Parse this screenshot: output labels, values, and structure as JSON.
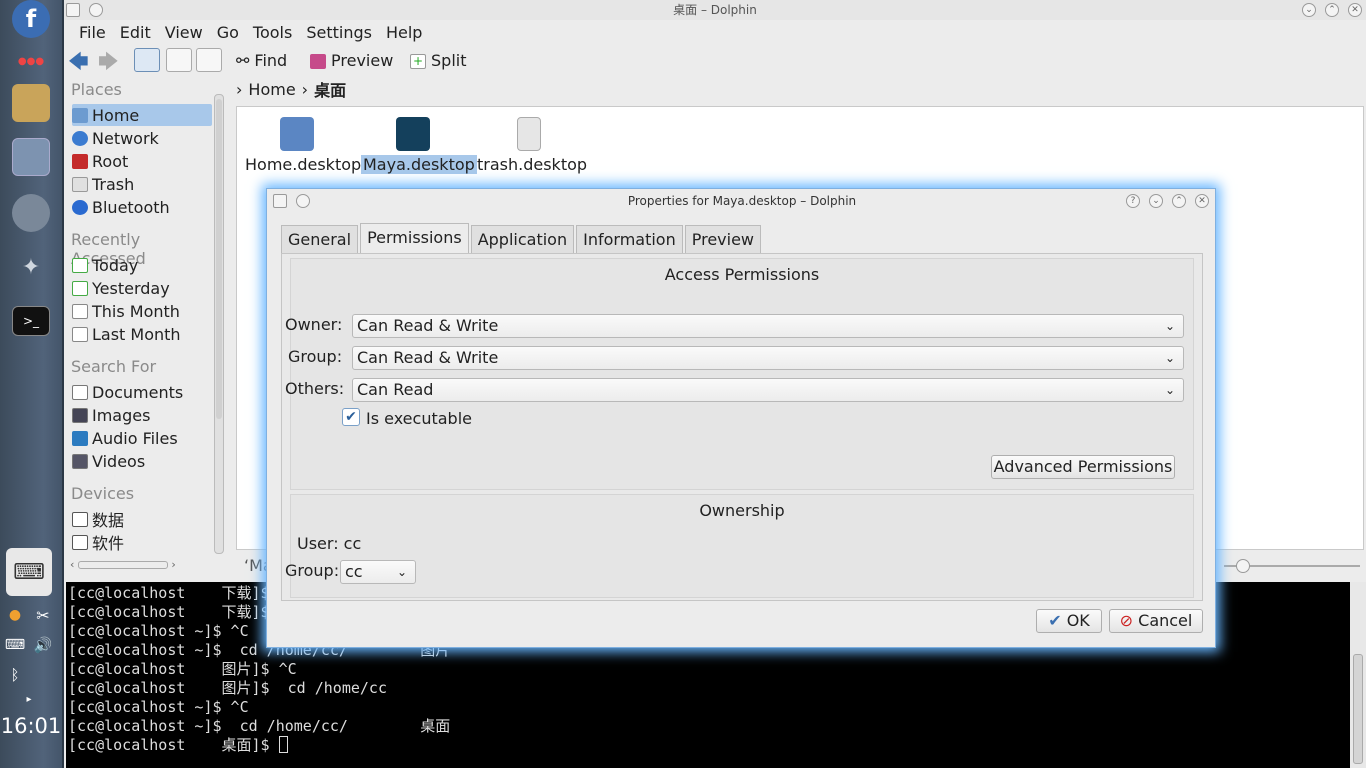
{
  "panel": {
    "clock": "16:01"
  },
  "window": {
    "title": "桌面 – Dolphin"
  },
  "menu": [
    "File",
    "Edit",
    "View",
    "Go",
    "Tools",
    "Settings",
    "Help"
  ],
  "toolbar": {
    "find": "Find",
    "preview": "Preview",
    "split": "Split"
  },
  "places": {
    "heading_places": "Places",
    "places": [
      "Home",
      "Network",
      "Root",
      "Trash",
      "Bluetooth"
    ],
    "heading_recent": "Recently Accessed",
    "recent": [
      "Today",
      "Yesterday",
      "This Month",
      "Last Month"
    ],
    "heading_search": "Search For",
    "search": [
      "Documents",
      "Images",
      "Audio Files",
      "Videos"
    ],
    "heading_devices": "Devices",
    "devices": [
      "数据",
      "软件"
    ]
  },
  "breadcrumb": {
    "home": "Home",
    "current": "桌面"
  },
  "files": [
    "Home.desktop",
    "Maya.desktop",
    "trash.desktop"
  ],
  "status_fragment": "‘Ma",
  "terminal": {
    "lines": [
      "[cc@localhost    下载]$ su",
      "[cc@localhost    下载]$ cd",
      "[cc@localhost ~]$ ^C",
      "[cc@localhost ~]$  cd /home/cc/        图片",
      "[cc@localhost    图片]$ ^C",
      "[cc@localhost    图片]$  cd /home/cc",
      "[cc@localhost ~]$ ^C",
      "[cc@localhost ~]$  cd /home/cc/        桌面",
      "[cc@localhost    桌面]$ "
    ]
  },
  "dialog": {
    "title": "Properties for Maya.desktop – Dolphin",
    "tabs": [
      "General",
      "Permissions",
      "Application",
      "Information",
      "Preview"
    ],
    "access_heading": "Access Permissions",
    "owner_label": "Owner:",
    "owner_value": "Can Read & Write",
    "group_label": "Group:",
    "group_value": "Can Read & Write",
    "others_label": "Others:",
    "others_value": "Can Read",
    "exec_label": "Is executable",
    "advanced_button": "Advanced Permissions",
    "ownership_heading": "Ownership",
    "user_text": "User: cc",
    "own_group_label": "Group:",
    "own_group_value": "cc",
    "ok": "OK",
    "cancel": "Cancel"
  }
}
